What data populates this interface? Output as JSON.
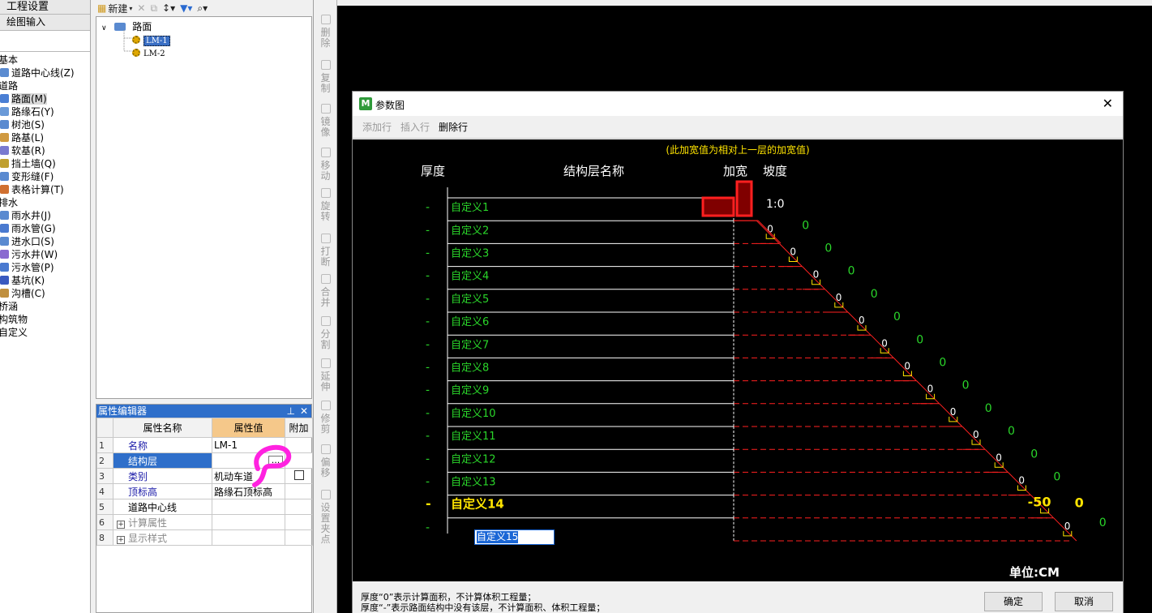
{
  "left_panel": {
    "tabs": [
      "工程设置",
      "绘图输入"
    ],
    "nav": [
      {
        "label": "基本",
        "type": "cat"
      },
      {
        "label": "道路中心线(Z)",
        "type": "item",
        "color": "#5b8bd0"
      },
      {
        "label": "道路",
        "type": "cat"
      },
      {
        "label": "路面(M)",
        "type": "item",
        "color": "#4a7fd4",
        "selected": true
      },
      {
        "label": "路缘石(Y)",
        "type": "item",
        "color": "#6a9ad8"
      },
      {
        "label": "树池(S)",
        "type": "item",
        "color": "#5a8ad0"
      },
      {
        "label": "路基(L)",
        "type": "item",
        "color": "#d09a40"
      },
      {
        "label": "软基(R)",
        "type": "item",
        "color": "#7a7ad0"
      },
      {
        "label": "挡土墙(Q)",
        "type": "item",
        "color": "#c0a030"
      },
      {
        "label": "变形缝(F)",
        "type": "item",
        "color": "#5a8ad0"
      },
      {
        "label": "表格计算(T)",
        "type": "item",
        "color": "#d07030"
      },
      {
        "label": "排水",
        "type": "cat"
      },
      {
        "label": "雨水井(J)",
        "type": "item",
        "color": "#5a8ad0"
      },
      {
        "label": "雨水管(G)",
        "type": "item",
        "color": "#4a7ad0"
      },
      {
        "label": "进水口(S)",
        "type": "item",
        "color": "#5a8ad0"
      },
      {
        "label": "污水井(W)",
        "type": "item",
        "color": "#8a6ad0"
      },
      {
        "label": "污水管(P)",
        "type": "item",
        "color": "#4a7ad0"
      },
      {
        "label": "基坑(K)",
        "type": "item",
        "color": "#3a5ac0"
      },
      {
        "label": "沟槽(C)",
        "type": "item",
        "color": "#c09040"
      },
      {
        "label": "桥涵",
        "type": "cat"
      },
      {
        "label": "构筑物",
        "type": "cat"
      },
      {
        "label": "自定义",
        "type": "cat"
      }
    ]
  },
  "tree_toolbar": {
    "new_label": "新建"
  },
  "tree": {
    "root": "路面",
    "children": [
      "LM-1",
      "LM-2"
    ]
  },
  "prop_editor": {
    "title": "属性编辑器",
    "headers": [
      "属性名称",
      "属性值",
      "附加"
    ],
    "rows": [
      {
        "n": "1",
        "name": "名称",
        "value": "LM-1"
      },
      {
        "n": "2",
        "name": "结构层",
        "value": "",
        "selected": true,
        "button": "..."
      },
      {
        "n": "3",
        "name": "类别",
        "value": "机动车道",
        "checkbox": true
      },
      {
        "n": "4",
        "name": "顶标高",
        "value": "路缘石顶标高"
      },
      {
        "n": "5",
        "name": "道路中心线",
        "value": "",
        "dark": true
      },
      {
        "n": "6",
        "name": "计算属性",
        "value": "",
        "expand": true
      },
      {
        "n": "8",
        "name": "显示样式",
        "value": "",
        "expand": true
      }
    ]
  },
  "vertical_tools": [
    "删除",
    "复制",
    "镜像",
    "移动",
    "旋转",
    "打断",
    "合并",
    "分割",
    "延伸",
    "修剪",
    "偏移",
    "设置夹点"
  ],
  "dialog": {
    "title": "参数图",
    "toolbar": {
      "add_row": "添加行",
      "insert_row": "插入行",
      "delete_row": "删除行"
    },
    "note": "(此加宽值为相对上一层的加宽值)",
    "headers": {
      "thickness": "厚度",
      "layer_name": "结构层名称",
      "widen": "加宽",
      "slope": "坡度"
    },
    "rows": [
      {
        "thickness": "-",
        "name": "自定义1",
        "widen": "",
        "slope": "1:0"
      },
      {
        "thickness": "-",
        "name": "自定义2",
        "widen": "0",
        "slope": "0"
      },
      {
        "thickness": "-",
        "name": "自定义3",
        "widen": "0",
        "slope": "0"
      },
      {
        "thickness": "-",
        "name": "自定义4",
        "widen": "0",
        "slope": "0"
      },
      {
        "thickness": "-",
        "name": "自定义5",
        "widen": "0",
        "slope": "0"
      },
      {
        "thickness": "-",
        "name": "自定义6",
        "widen": "0",
        "slope": "0"
      },
      {
        "thickness": "-",
        "name": "自定义7",
        "widen": "0",
        "slope": "0"
      },
      {
        "thickness": "-",
        "name": "自定义8",
        "widen": "0",
        "slope": "0"
      },
      {
        "thickness": "-",
        "name": "自定义9",
        "widen": "0",
        "slope": "0"
      },
      {
        "thickness": "-",
        "name": "自定义10",
        "widen": "0",
        "slope": "0"
      },
      {
        "thickness": "-",
        "name": "自定义11",
        "widen": "0",
        "slope": "0"
      },
      {
        "thickness": "-",
        "name": "自定义12",
        "widen": "0",
        "slope": "0"
      },
      {
        "thickness": "-",
        "name": "自定义13",
        "widen": "0",
        "slope": "0"
      },
      {
        "thickness": "-",
        "name": "自定义14",
        "widen": "-50",
        "slope": "0",
        "highlight": true
      },
      {
        "thickness": "-",
        "name": "自定义15",
        "widen": "0",
        "slope": "0",
        "editing": true
      }
    ],
    "edit_value": "自定义15",
    "unit": "单位:CM",
    "footer_notes": [
      "厚度“0”表示计算面积，不计算体积工程量；",
      "厚度“-”表示路面结构中没有该层，不计算面积、体积工程量；"
    ],
    "ok": "确定",
    "cancel": "取消",
    "colors": {
      "label_green": "#2ad62a",
      "highlight_yellow": "#ffe400",
      "line_red": "#ff2020",
      "edit_blue": "#1a66d6"
    }
  }
}
